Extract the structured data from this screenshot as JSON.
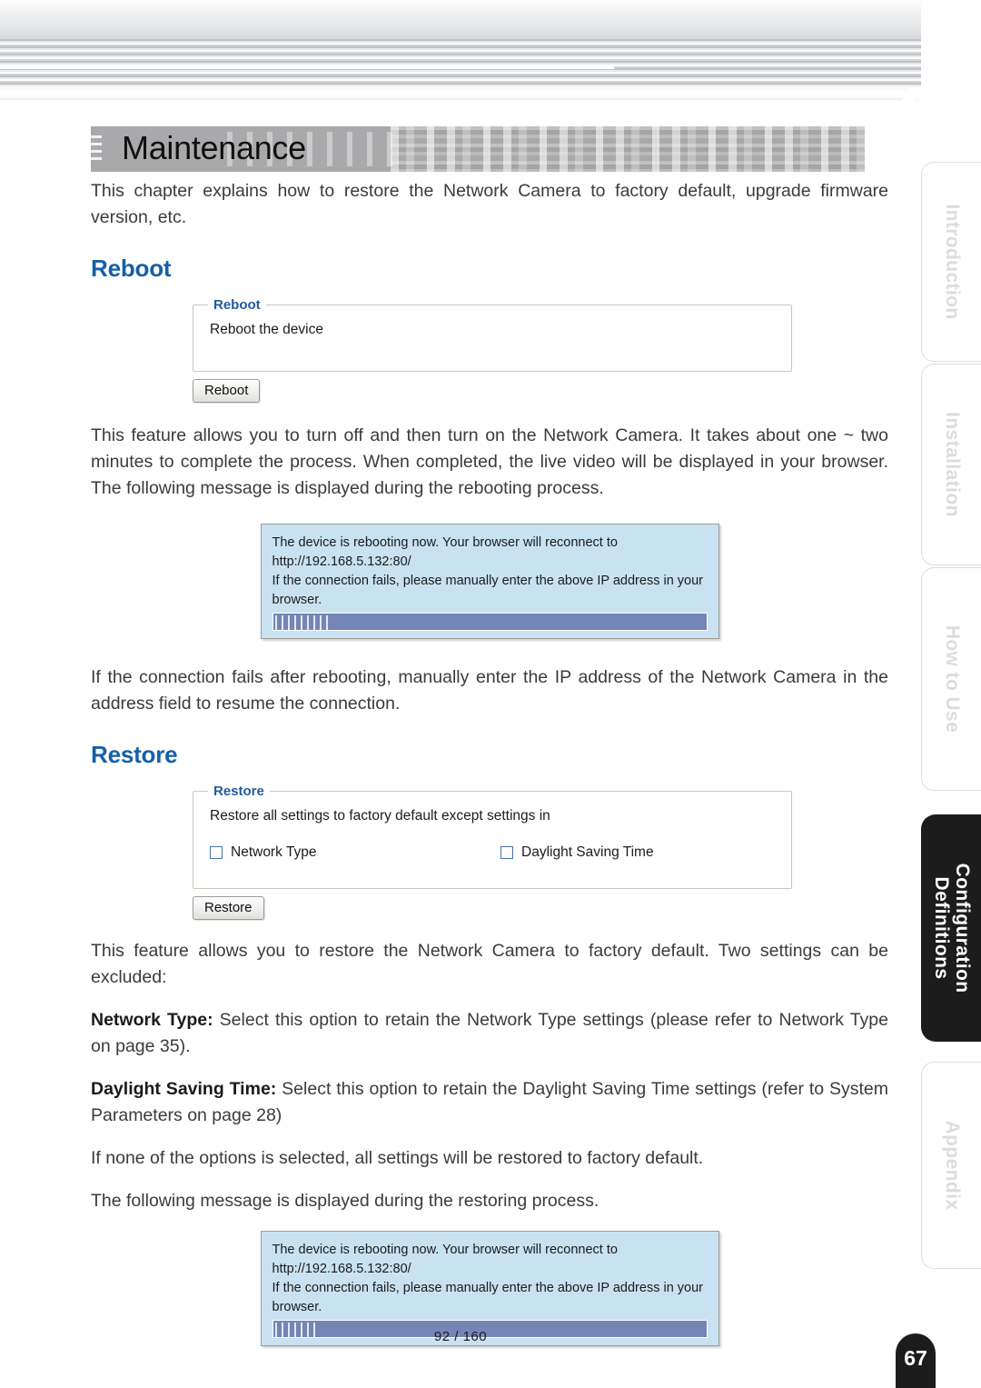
{
  "chapter": {
    "title": "Maintenance",
    "intro": "This chapter explains how to restore the Network Camera to factory default, upgrade firmware version, etc."
  },
  "reboot": {
    "heading": "Reboot",
    "panel": {
      "legend": "Reboot",
      "description": "Reboot the device",
      "button_label": "Reboot"
    },
    "paragraph": "This feature allows you to turn off and then turn on the Network Camera. It takes about one ~ two minutes to complete the process. When completed, the live video will be displayed in your browser. The following message is displayed during the rebooting process.",
    "after_paragraph": "If the connection fails after rebooting, manually enter the IP address of the Network Camera in the address field to resume the connection."
  },
  "reboot_dialog": {
    "line1": "The device is rebooting now. Your browser will reconnect to",
    "line2": "http://192.168.5.132:80/",
    "line3": "If the connection fails, please manually enter the above IP address in your",
    "line4": "browser.",
    "progress_percent": 12,
    "fill_color": "#7585b5",
    "background_color": "#c9e2f2"
  },
  "restore": {
    "heading": "Restore",
    "panel": {
      "legend": "Restore",
      "description": "Restore all settings to factory default except settings in",
      "checkbox_1_label": "Network Type",
      "checkbox_1_checked": false,
      "checkbox_2_label": "Daylight Saving Time",
      "checkbox_2_checked": false,
      "button_label": "Restore"
    },
    "paragraph": "This feature allows you to restore the Network Camera to factory default. Two settings can be excluded:",
    "network_type_term": "Network Type:",
    "network_type_text": " Select this option to retain the Network Type settings (please refer to Network Type on page 35).",
    "dst_term": "Daylight Saving Time:",
    "dst_text": " Select this option to retain the Daylight Saving Time settings (refer to System Parameters on page 28)",
    "none_selected": "If none of the options is selected, all settings will be restored to factory default.",
    "following_message": "The following message is displayed during the restoring process."
  },
  "restore_dialog": {
    "line1": "The device is rebooting now. Your browser will reconnect to",
    "line2": "http://192.168.5.132:80/",
    "line3": "If the connection fails, please manually enter the above IP address in your",
    "line4": "browser.",
    "progress_percent": 10
  },
  "side_tabs": [
    {
      "label": "Introduction",
      "active": false
    },
    {
      "label": "Installation",
      "active": false
    },
    {
      "label": "How to Use",
      "active": false
    },
    {
      "label": "Configuration\nDefinitions",
      "active": true
    },
    {
      "label": "Appendix",
      "active": false
    }
  ],
  "footer": {
    "page_counter": "92 / 160",
    "page_number": "67"
  },
  "colors": {
    "heading_blue": "#1560a8",
    "legend_blue": "#235b9e",
    "dialog_blue": "#c9e2f2",
    "progress_blue": "#7585b5",
    "tab_active": "#1c1c1c"
  }
}
